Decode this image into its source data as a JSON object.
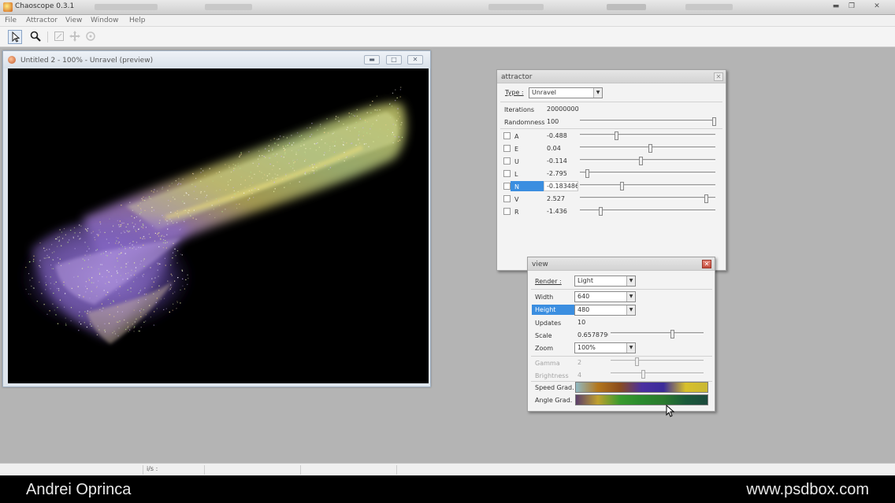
{
  "app": {
    "title": "Chaoscope 0.3.1"
  },
  "menu": [
    "File",
    "Attractor",
    "View",
    "Window",
    "Help"
  ],
  "toolbar": {
    "tools": [
      "select-tool",
      "zoom-tool",
      "frame-tool",
      "move-tool",
      "rotate-tool"
    ]
  },
  "document": {
    "title": "Untitled 2 - 100% - Unravel (preview)"
  },
  "attractor": {
    "title": "attractor",
    "type_label": "Type :",
    "type_value": "Unravel",
    "iterations_label": "Iterations",
    "iterations_value": "20000000",
    "randomness_label": "Randomness",
    "randomness_value": "100",
    "randomness_level": 0.99,
    "params": [
      {
        "name": "A",
        "value": "-0.488",
        "level": 0.27
      },
      {
        "name": "E",
        "value": "0.04",
        "level": 0.52
      },
      {
        "name": "U",
        "value": "-0.114",
        "level": 0.45
      },
      {
        "name": "L",
        "value": "-2.795",
        "level": 0.05
      },
      {
        "name": "N",
        "value": "-0.183486",
        "level": 0.31,
        "selected": true
      },
      {
        "name": "V",
        "value": "2.527",
        "level": 0.93
      },
      {
        "name": "R",
        "value": "-1.436",
        "level": 0.15
      }
    ]
  },
  "view": {
    "title": "view",
    "render_label": "Render :",
    "render_value": "Light",
    "width_label": "Width",
    "width_value": "640",
    "height_label": "Height",
    "height_value": "480",
    "updates_label": "Updates",
    "updates_value": "10",
    "scale_label": "Scale",
    "scale_value": "0.6578790",
    "scale_level": 0.66,
    "zoom_label": "Zoom",
    "zoom_value": "100%",
    "gamma_label": "Gamma",
    "gamma_value": "2",
    "gamma_level": 0.28,
    "brightness_label": "Brightness",
    "brightness_value": "4",
    "brightness_level": 0.35,
    "speed_grad_label": "Speed Grad.",
    "angle_grad_label": "Angle Grad.",
    "speed_grad_colors": [
      "#8fb9c4",
      "#b3761b",
      "#8a4c1d",
      "#4a2fa0",
      "#3b2c9a",
      "#d8c02b",
      "#c9b834"
    ],
    "angle_grad_colors": [
      "#5b3e6c",
      "#c0a02e",
      "#3a9b2e",
      "#2a8a2e",
      "#2b7a2e",
      "#1a5a3a",
      "#1c4a3d"
    ]
  },
  "status": {
    "fps": "i/s :"
  },
  "credits": {
    "author": "Andrei Oprinca",
    "site": "www.psdbox.com"
  }
}
